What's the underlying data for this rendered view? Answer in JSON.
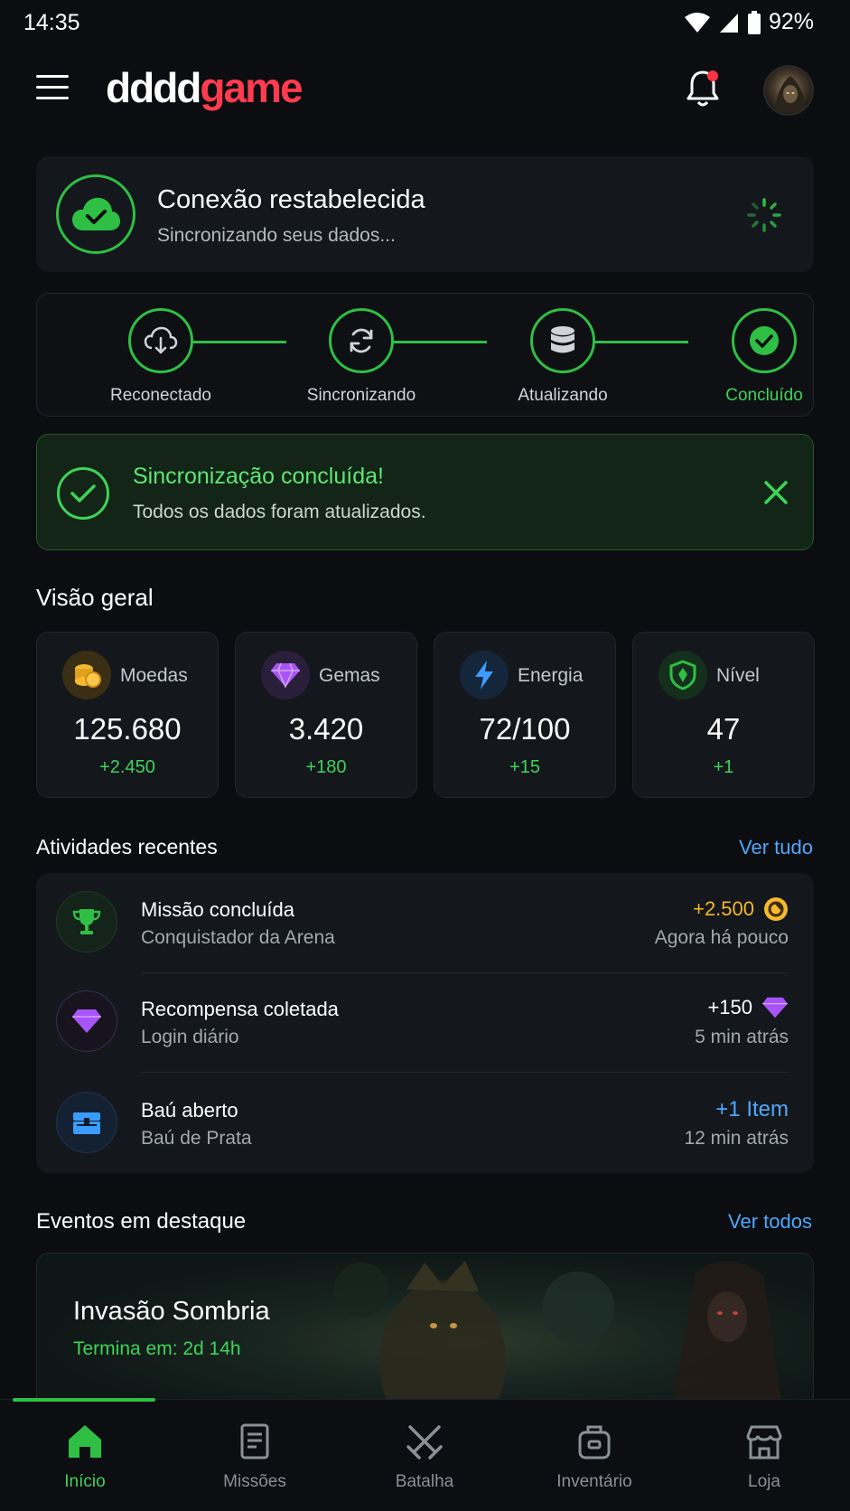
{
  "status_bar": {
    "time": "14:35",
    "battery": "92%"
  },
  "header": {
    "logo_part1": "dddd",
    "logo_part2": "game"
  },
  "connection": {
    "title": "Conexão restabelecida",
    "subtitle": "Sincronizando seus dados..."
  },
  "steps": [
    {
      "label": "Reconectado",
      "icon": "cloud-download-icon"
    },
    {
      "label": "Sincronizando",
      "icon": "sync-icon"
    },
    {
      "label": "Atualizando",
      "icon": "database-icon"
    },
    {
      "label": "Concluído",
      "icon": "check-icon"
    }
  ],
  "success": {
    "title": "Sincronização concluída!",
    "subtitle": "Todos os dados foram atualizados."
  },
  "overview": {
    "title": "Visão geral",
    "stats": [
      {
        "label": "Moedas",
        "value": "125.680",
        "delta": "+2.450",
        "icon": "coins-icon"
      },
      {
        "label": "Gemas",
        "value": "3.420",
        "delta": "+180",
        "icon": "gem-icon"
      },
      {
        "label": "Energia",
        "value": "72/100",
        "delta": "+15",
        "icon": "lightning-icon"
      },
      {
        "label": "Nível",
        "value": "47",
        "delta": "+1",
        "icon": "shield-icon"
      }
    ]
  },
  "activities": {
    "title": "Atividades recentes",
    "see_all": "Ver tudo",
    "items": [
      {
        "title": "Missão concluída",
        "subtitle": "Conquistador da Arena",
        "amount": "+2.500",
        "time": "Agora há pouco",
        "icon": "trophy-icon",
        "amount_color": "#f5b82e"
      },
      {
        "title": "Recompensa coletada",
        "subtitle": "Login diário",
        "amount": "+150",
        "time": "5 min atrás",
        "icon": "gem-icon",
        "amount_color": "#ffffff"
      },
      {
        "title": "Baú aberto",
        "subtitle": "Baú de Prata",
        "amount": "+1 Item",
        "time": "12 min atrás",
        "icon": "chest-icon",
        "amount_color": "#4ea8ff"
      }
    ]
  },
  "events": {
    "title": "Eventos em destaque",
    "see_all": "Ver todos",
    "featured": {
      "title": "Invasão Sombria",
      "time": "Termina em: 2d 14h"
    }
  },
  "nav": [
    {
      "label": "Início",
      "icon": "home-icon",
      "active": true
    },
    {
      "label": "Missões",
      "icon": "missions-icon",
      "active": false
    },
    {
      "label": "Batalha",
      "icon": "swords-icon",
      "active": false
    },
    {
      "label": "Inventário",
      "icon": "backpack-icon",
      "active": false
    },
    {
      "label": "Loja",
      "icon": "store-icon",
      "active": false
    }
  ],
  "colors": {
    "accent": "#2fbf44",
    "brand": "#ff3b4e",
    "link": "#4ea8ff",
    "gold": "#f5b82e",
    "purple": "#a855f7"
  }
}
